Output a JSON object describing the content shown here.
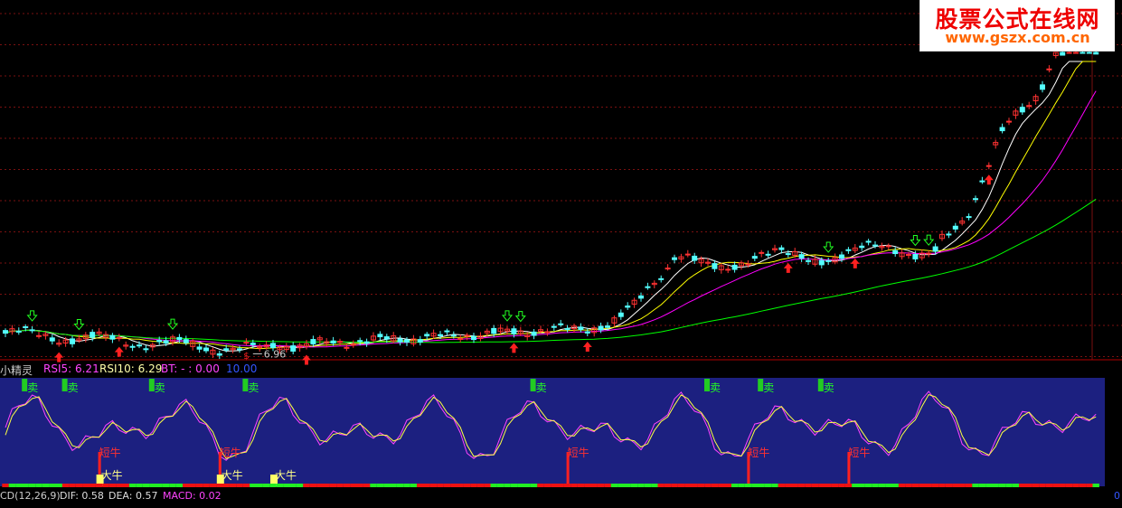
{
  "watermark": {
    "line1": "股票公式在线网",
    "line2": "www.gszx.com.cn"
  },
  "indicator_header": {
    "name": "小精灵",
    "rsi5": "RSI5: 6.21",
    "rsi10": "RSI10: 6.29",
    "bt": "BT: - : 0.00",
    "val": "10.00"
  },
  "macd_header": {
    "params": "CD(12,26,9)",
    "dif": "DIF: 0.58",
    "dea": "DEA: 0.57",
    "macd": "MACD: 0.02"
  },
  "right_edge_label": "0",
  "colors": {
    "up": "#ff3232",
    "down": "#54ffff",
    "ma5": "#ffffff",
    "ma10": "#ffff00",
    "ma20": "#ff00ff",
    "ma60": "#00ff00",
    "panel": "#1c2080",
    "rsi5": "#ff44ff",
    "rsi10": "#ffff44"
  },
  "chart_data": [
    {
      "type": "candlestick",
      "annotations": [
        {
          "text": "6.96",
          "index": 37,
          "kind": "low-price"
        }
      ],
      "buy_arrow_indices": [
        8,
        17,
        45,
        76,
        87,
        117,
        127,
        147
      ],
      "sell_arrow_indices": [
        4,
        11,
        25,
        77,
        75,
        123,
        136,
        138
      ],
      "s_marker_index": 36
    },
    {
      "type": "line",
      "name": "小精灵",
      "sell_labels": [
        {
          "text": "卖",
          "index": 3
        },
        {
          "text": "卖",
          "index": 9
        },
        {
          "text": "卖",
          "index": 22
        },
        {
          "text": "卖",
          "index": 36
        },
        {
          "text": "卖",
          "index": 79
        },
        {
          "text": "卖",
          "index": 105
        },
        {
          "text": "卖",
          "index": 113
        },
        {
          "text": "卖",
          "index": 122
        }
      ],
      "short_bull_labels": [
        {
          "text": "短牛",
          "index": 14
        },
        {
          "text": "短牛",
          "index": 32
        },
        {
          "text": "短牛",
          "index": 84
        },
        {
          "text": "短牛",
          "index": 111
        },
        {
          "text": "短牛",
          "index": 126
        }
      ],
      "big_bull_labels": [
        {
          "text": "大牛",
          "index": 14
        },
        {
          "text": "大牛",
          "index": 32
        },
        {
          "text": "大牛",
          "index": 40
        }
      ]
    }
  ]
}
